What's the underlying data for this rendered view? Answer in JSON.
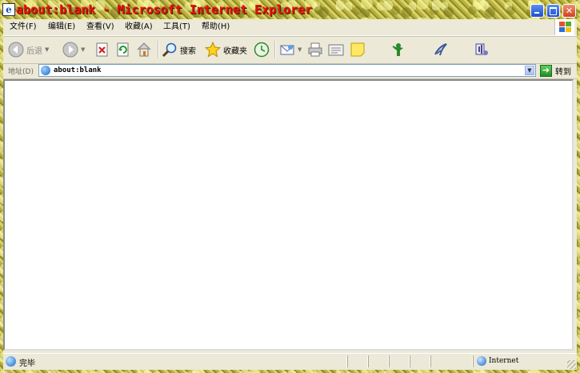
{
  "window": {
    "title": "about:blank - Microsoft Internet Explorer",
    "controls": {
      "minimize": "minimize-icon",
      "maximize": "maximize-icon",
      "close": "close-icon"
    }
  },
  "menu": [
    "文件(F)",
    "编辑(E)",
    "查看(V)",
    "收藏(A)",
    "工具(T)",
    "帮助(H)"
  ],
  "toolbar": {
    "back_label": "后退",
    "search_label": "搜索",
    "favorites_label": "收藏夹"
  },
  "address": {
    "label": "地址(D)",
    "value": "about:blank",
    "go_label": "转到"
  },
  "status": {
    "text": "完毕",
    "zone": "Internet"
  },
  "colors": {
    "title_text": "#e81010",
    "frame": "#ece9d8",
    "title_buttons": "#1d4fd0",
    "close_button": "#d04020"
  }
}
